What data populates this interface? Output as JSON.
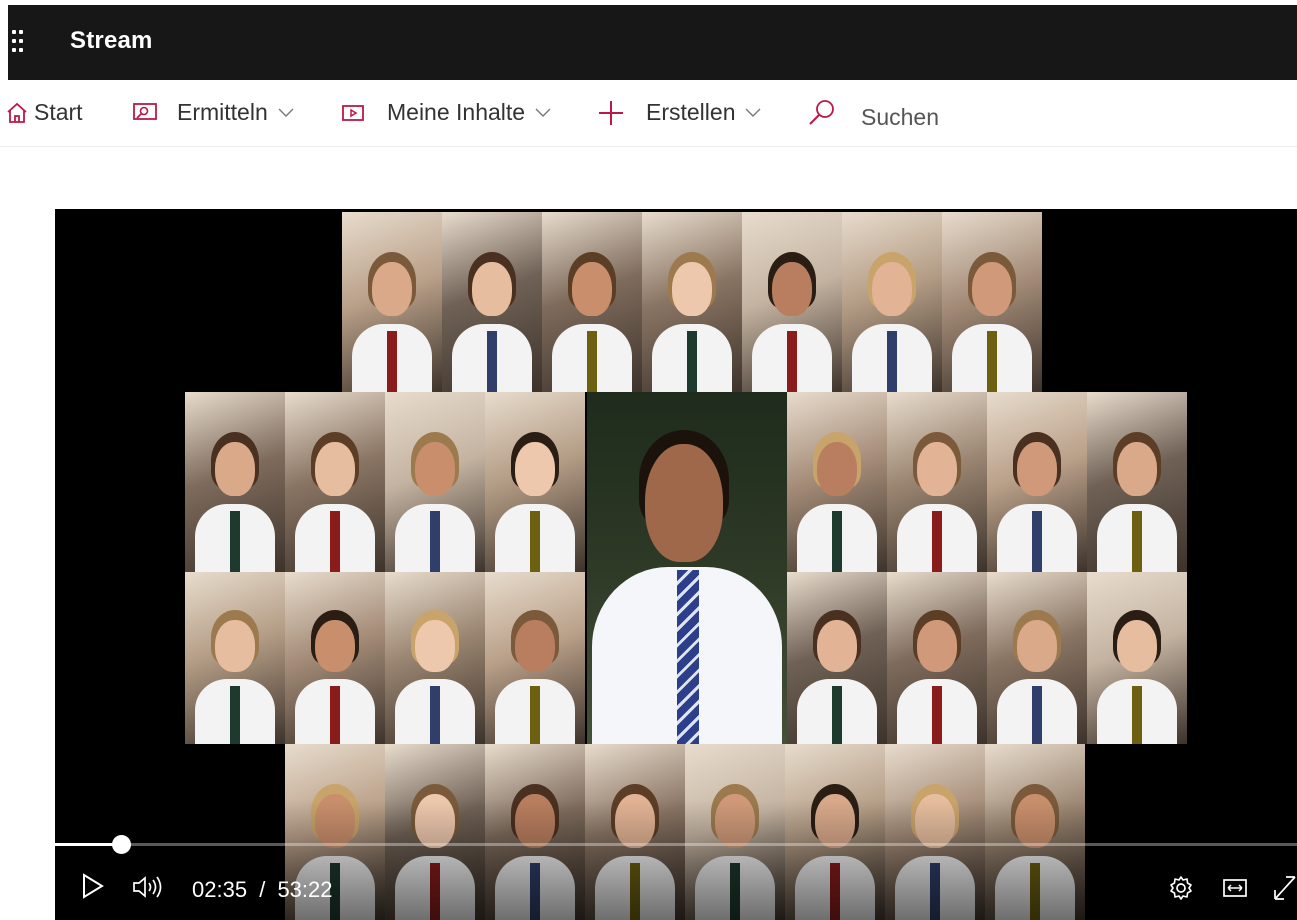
{
  "header": {
    "app_title": "Stream"
  },
  "nav": {
    "home": "Start",
    "discover": "Ermitteln",
    "my_content": "Meine Inhalte",
    "create": "Erstellen",
    "search_placeholder": "Suchen"
  },
  "player": {
    "current_time": "02:35",
    "separator": "/",
    "duration": "53:22",
    "progress_fraction": 0.0486
  },
  "colors": {
    "topbar": "#171717",
    "accent": "#bc1948",
    "player_bg": "#000000"
  },
  "icons": [
    "app-launcher-icon",
    "home-icon",
    "discover-icon",
    "my-content-icon",
    "create-icon",
    "search-icon",
    "play-icon",
    "volume-icon",
    "settings-icon",
    "theater-mode-icon",
    "fullscreen-icon",
    "chevron-down-icon"
  ]
}
